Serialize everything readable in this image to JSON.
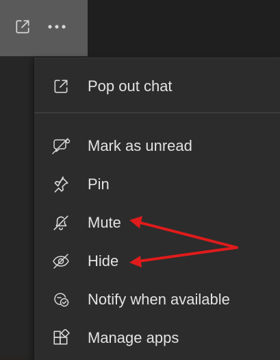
{
  "topbar": {
    "popout_icon": "popout-icon",
    "more_icon": "more-options-icon"
  },
  "menu": {
    "items": [
      {
        "label": "Pop out chat",
        "icon": "popout-icon"
      },
      {
        "label": "Mark as unread",
        "icon": "mark-unread-icon"
      },
      {
        "label": "Pin",
        "icon": "pin-icon"
      },
      {
        "label": "Mute",
        "icon": "bell-off-icon"
      },
      {
        "label": "Hide",
        "icon": "eye-off-icon"
      },
      {
        "label": "Notify when available",
        "icon": "notify-available-icon"
      },
      {
        "label": "Manage apps",
        "icon": "apps-icon"
      }
    ]
  },
  "annotation": {
    "arrow_color": "#e01b1b",
    "targets": [
      "Mute",
      "Hide"
    ]
  },
  "colors": {
    "menu_bg": "#2d2c2c",
    "text": "#e3e3e3",
    "button_bg": "#5a5a5a"
  }
}
